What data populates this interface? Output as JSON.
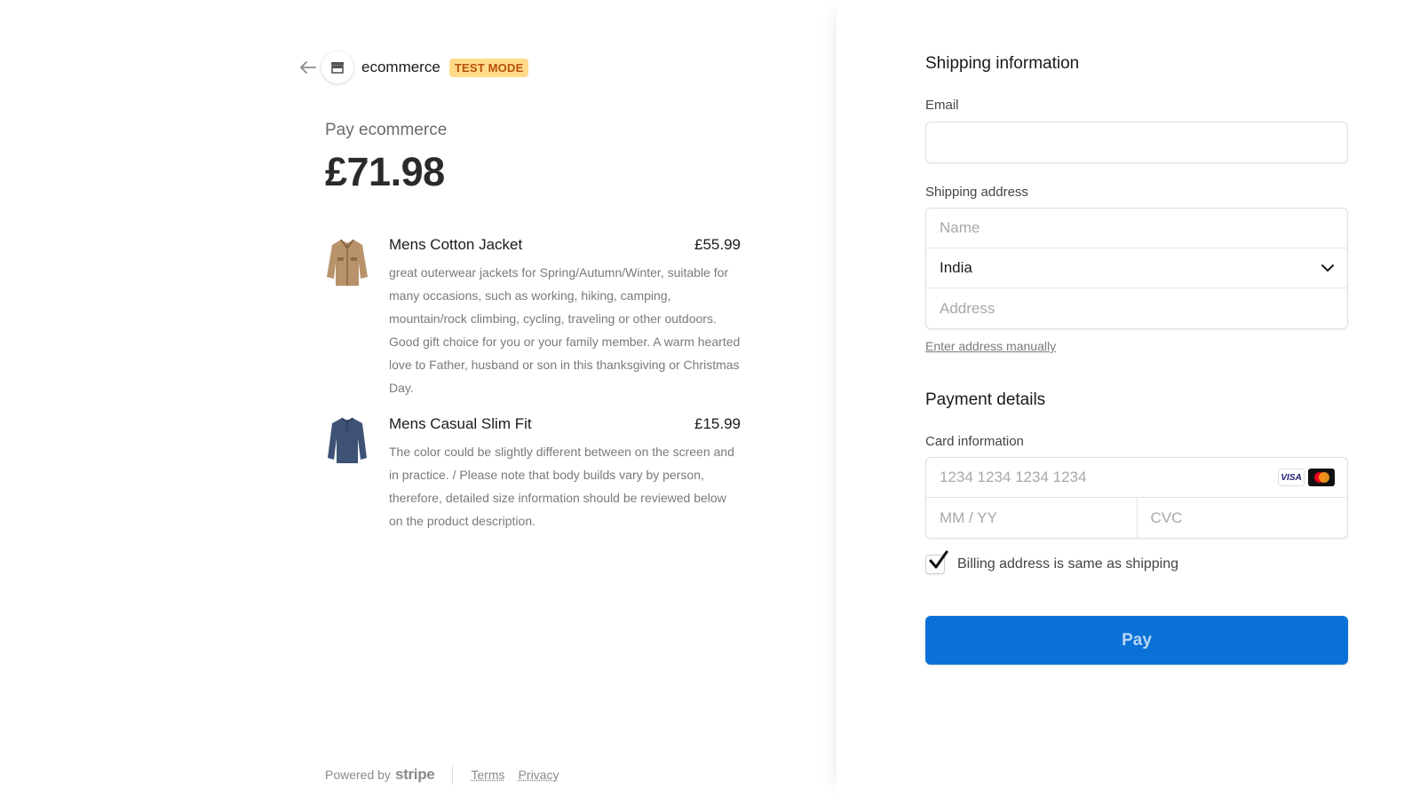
{
  "header": {
    "merchant_name": "ecommerce",
    "test_badge": "TEST MODE",
    "icons": {
      "back": "arrow-left-icon",
      "merchant_logo": "store-icon"
    }
  },
  "summary": {
    "pay_label": "Pay ecommerce",
    "total": "£71.98"
  },
  "line_items": [
    {
      "name": "Mens Cotton Jacket",
      "price": "£55.99",
      "description": "great outerwear jackets for Spring/Autumn/Winter, suitable for many occasions, such as working, hiking, camping, mountain/rock climbing, cycling, traveling or other outdoors. Good gift choice for you or your family member. A warm hearted love to Father, husband or son in this thanksgiving or Christmas Day.",
      "image_icon": "jacket-image"
    },
    {
      "name": "Mens Casual Slim Fit",
      "price": "£15.99",
      "description": "The color could be slightly different between on the screen and in practice. / Please note that body builds vary by person, therefore, detailed size information should be reviewed below on the product description.",
      "image_icon": "shirt-image"
    }
  ],
  "footer": {
    "powered_by": "Powered by",
    "stripe": "stripe",
    "terms": "Terms",
    "privacy": "Privacy"
  },
  "shipping": {
    "title": "Shipping information",
    "email_label": "Email",
    "email_value": "",
    "address_label": "Shipping address",
    "name_placeholder": "Name",
    "country": "India",
    "address_placeholder": "Address",
    "manual_link": "Enter address manually"
  },
  "payment": {
    "title": "Payment details",
    "card_label": "Card information",
    "card_number_placeholder": "1234 1234 1234 1234",
    "expiry_placeholder": "MM / YY",
    "cvc_placeholder": "CVC",
    "card_brands": [
      "visa-icon",
      "mastercard-icon"
    ],
    "visa_text": "VISA",
    "billing_same_label": "Billing address is same as shipping",
    "billing_same_checked": true,
    "pay_button": "Pay"
  },
  "colors": {
    "accent": "#0a71d6",
    "badge_bg": "#ffdb8a",
    "badge_text": "#b8500a"
  }
}
